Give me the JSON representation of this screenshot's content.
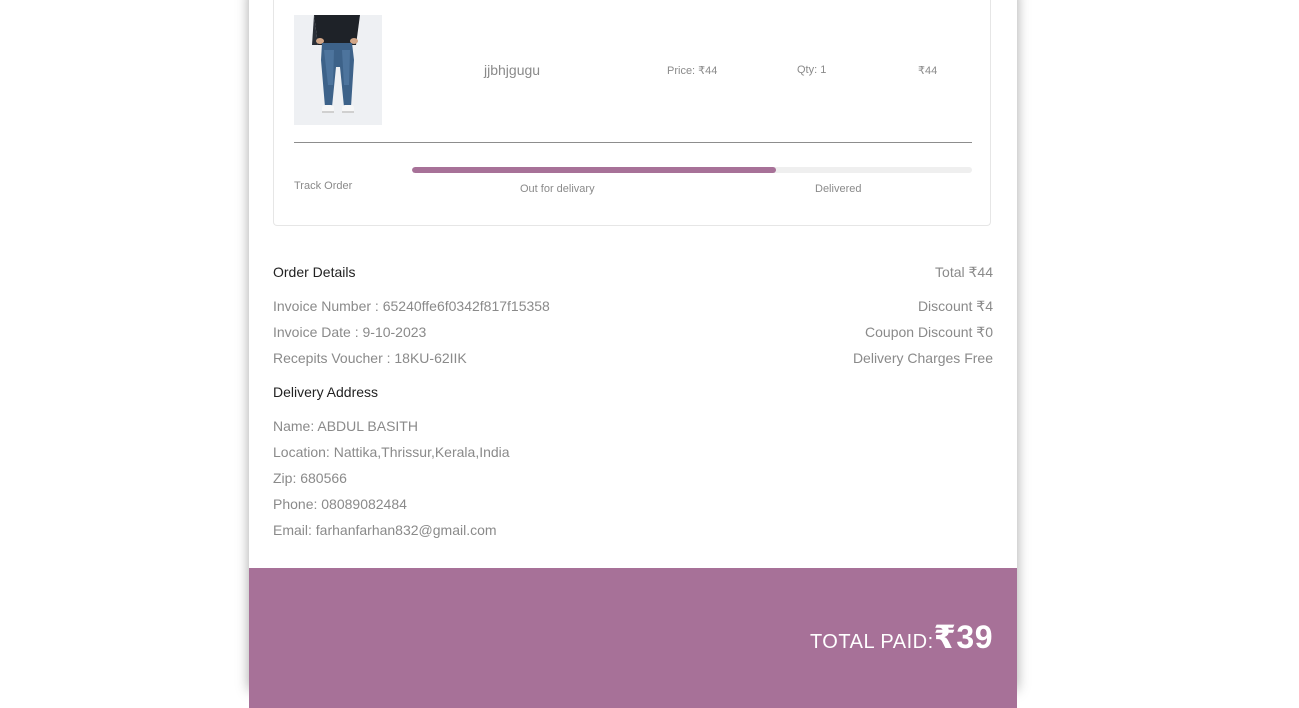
{
  "product": {
    "name": "jjbhjgugu",
    "price": "Price: ₹44",
    "qty": "Qty: 1",
    "line_total": "₹44"
  },
  "tracking": {
    "label": "Track Order",
    "stages": [
      "Out for delivary",
      "Delivered"
    ],
    "progress": 0.65
  },
  "order_details": {
    "title": "Order Details",
    "total": "Total ₹44",
    "invoice_number": "Invoice Number : 65240ffe6f0342f817f15358",
    "invoice_date": "Invoice Date : 9-10-2023",
    "receipts_voucher": "Recepits Voucher : 18KU-62IIK",
    "discount": "Discount ₹4",
    "coupon_discount": "Coupon Discount ₹0",
    "delivery_charges": "Delivery Charges Free"
  },
  "delivery_address": {
    "title": "Delivery Address",
    "name": "Name: ABDUL BASITH",
    "location": "Location: Nattika,Thrissur,Kerala,India",
    "zip": "Zip: 680566",
    "phone": "Phone: 08089082484",
    "email": "Email: farhanfarhan832@gmail.com"
  },
  "footer": {
    "total_paid_label": "TOTAL PAID:",
    "total_paid_amount": "₹39"
  },
  "colors": {
    "accent": "#a77198",
    "text_muted": "#8a8a8a",
    "text_dark": "#222222"
  }
}
